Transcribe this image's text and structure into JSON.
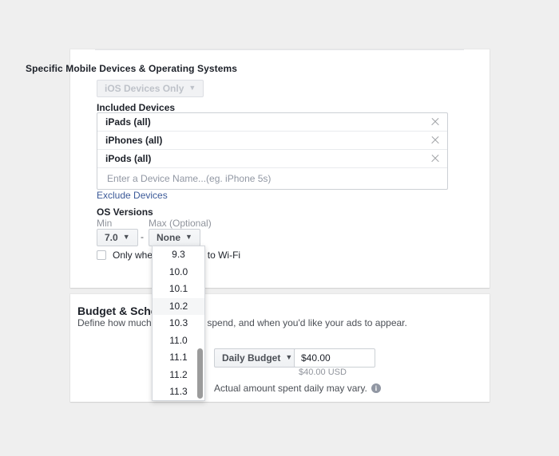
{
  "devices_card": {
    "heading": "Specific Mobile Devices & Operating Systems",
    "platform_select": {
      "label": "iOS Devices Only",
      "caret": "▼",
      "disabled": true
    },
    "included_devices_label": "Included Devices",
    "included_devices": [
      {
        "name": "iPads (all)",
        "remove_icon": "close-icon"
      },
      {
        "name": "iPhones (all)",
        "remove_icon": "close-icon"
      },
      {
        "name": "iPods (all)",
        "remove_icon": "close-icon"
      }
    ],
    "device_input": {
      "value": "",
      "placeholder": "Enter a Device Name...(eg. iPhone 5s)"
    },
    "exclude_devices_link": "Exclude Devices",
    "os_versions": {
      "title": "OS Versions",
      "min_label": "Min",
      "max_label": "Max (Optional)",
      "min_value": "7.0",
      "separator": "-",
      "max_value": "None",
      "caret": "▼"
    },
    "wifi_checkbox": {
      "label": "Only when connected to Wi-Fi",
      "checked": false
    }
  },
  "os_dropdown": {
    "open": true,
    "options": [
      "9.3",
      "10.0",
      "10.1",
      "10.2",
      "10.3",
      "11.0",
      "11.1",
      "11.2",
      "11.3"
    ],
    "highlighted": "10.2",
    "scrollbar": {
      "visible": true
    }
  },
  "budget_card": {
    "heading": "Budget & Schedule",
    "subheading": "Define how much you'd like to spend, and when you'd like your ads to appear.",
    "budget_type": {
      "label": "Daily Budget",
      "caret": "▼"
    },
    "amount": {
      "value": "$40.00",
      "placeholder": ""
    },
    "currency_note": "$40.00 USD",
    "note": "Actual amount spent daily may vary.",
    "info_icon": "info-icon"
  },
  "colors": {
    "page_background": "#efefef",
    "card_background": "#ffffff",
    "link_blue": "#3b5998",
    "text_primary": "#1d2129",
    "text_muted": "#90949c",
    "border": "#ccd0d5",
    "highlight_row": "#f5f6f7"
  }
}
